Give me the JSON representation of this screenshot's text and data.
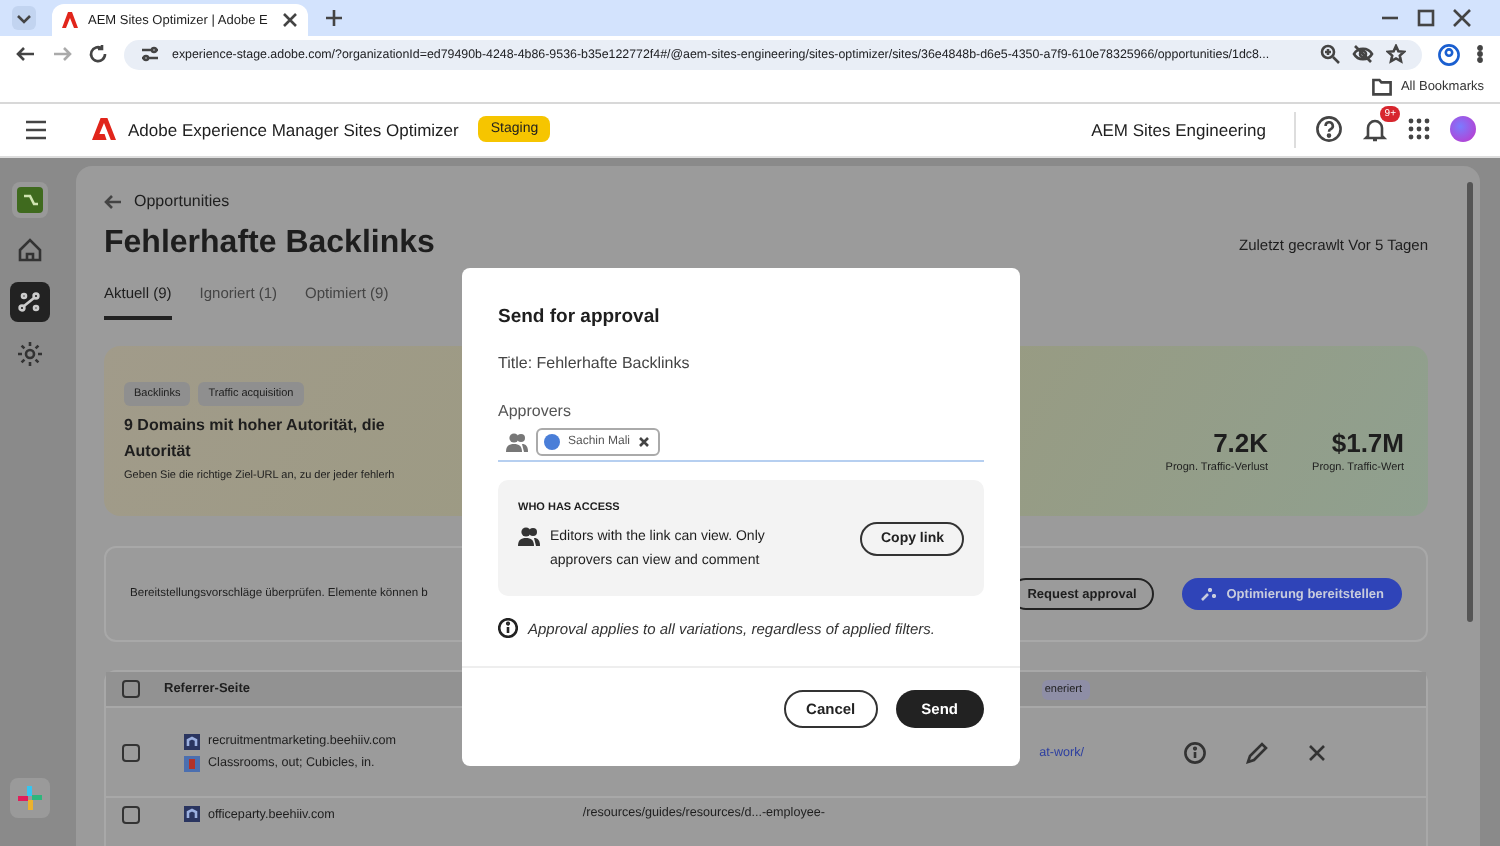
{
  "browser": {
    "tab_title": "AEM Sites Optimizer | Adobe E",
    "url": "experience-stage.adobe.com/?organizationId=ed79490b-4248-4b86-9536-b35e122772f4#/@aem-sites-engineering/sites-optimizer/sites/36e4848b-d6e5-4350-a7f9-610e78325966/opportunities/1dc8...",
    "bookmarks": "All Bookmarks"
  },
  "app_header": {
    "product": "Adobe Experience Manager Sites Optimizer",
    "environment": "Staging",
    "org": "AEM Sites Engineering",
    "notification_count": "9+"
  },
  "rail": [
    {
      "selected": false
    },
    {
      "selected": true
    },
    {
      "selected": false
    }
  ],
  "page": {
    "back_link": "Opportunities",
    "title": "Fehlerhafte Backlinks",
    "last_crawled": "Zuletzt gecrawlt Vor 5 Tagen",
    "tabs": [
      {
        "label": "Aktuell (9)",
        "selected": true
      },
      {
        "label": "Ignoriert (1)",
        "selected": false
      },
      {
        "label": "Optimiert (9)",
        "selected": false
      }
    ]
  },
  "card": {
    "tags": [
      "Backlinks",
      "Traffic acquisition"
    ],
    "heading_lines": [
      "9 Domains mit hoher Autorität, die",
      "Autorität"
    ],
    "description": "Geben Sie die richtige Ziel-URL an, zu der jeder fehlerh",
    "metrics": [
      {
        "value": "7.2K",
        "label": "Progn. Traffic-Verlust"
      },
      {
        "value": "$1.7M",
        "label": "Progn. Traffic-Wert"
      }
    ]
  },
  "actions": {
    "note": "Bereitstellungsvorschläge überprüfen. Elemente können b",
    "buttons": [
      {
        "label": "Request approval",
        "kind": "outline"
      },
      {
        "label": "Optimierung bereitstellen",
        "kind": "primary"
      }
    ]
  },
  "table": {
    "all_checked": false,
    "columns": [
      "Referrer-Seite",
      "eneriert"
    ],
    "rows": [
      {
        "checked": false,
        "domain": "recruitmentmarketing.beehiiv.com",
        "title": "Classrooms, out; Cubicles, in.",
        "target": "at-work/"
      },
      {
        "checked": false,
        "domain": "officeparty.beehiiv.com",
        "target": "/resources/guides/resources/d...-employee-"
      }
    ]
  },
  "modal": {
    "title": "Send for approval",
    "subtitle": "Title: Fehlerhafte Backlinks",
    "approvers_label": "Approvers",
    "approvers": [
      {
        "name": "Sachin Mali"
      }
    ],
    "access": {
      "heading": "WHO HAS ACCESS",
      "text": "Editors with the link can view. Only approvers can view and comment",
      "button": "Copy link"
    },
    "note": "Approval applies to all variations, regardless of applied filters.",
    "buttons": [
      {
        "label": "Cancel",
        "kind": "secondary"
      },
      {
        "label": "Send",
        "kind": "primary"
      }
    ]
  }
}
